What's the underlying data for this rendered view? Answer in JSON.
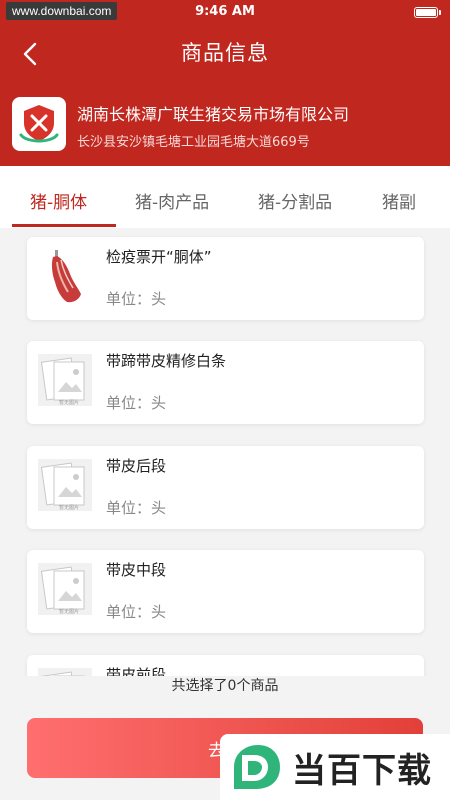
{
  "status": {
    "watermark_url": "www.downbai.com",
    "time": "9:46 AM"
  },
  "header": {
    "title": "商品信息",
    "company_name": "湖南长株潭广联生猪交易市场有限公司",
    "company_address": "长沙县安沙镇毛塘工业园毛塘大道669号"
  },
  "tabs": [
    {
      "label": "猪-胴体",
      "active": true
    },
    {
      "label": "猪-肉产品",
      "active": false
    },
    {
      "label": "猪-分割品",
      "active": false
    },
    {
      "label": "猪副",
      "active": false
    }
  ],
  "products": [
    {
      "title": "检疫票开“胴体”",
      "unit": "单位：头",
      "image": "pork-carcass"
    },
    {
      "title": "带蹄带皮精修白条",
      "unit": "单位：头",
      "image": "image-placeholder"
    },
    {
      "title": "带皮后段",
      "unit": "单位：头",
      "image": "image-placeholder"
    },
    {
      "title": "带皮中段",
      "unit": "单位：头",
      "image": "image-placeholder"
    },
    {
      "title": "带皮前段",
      "unit": "",
      "image": "image-placeholder"
    }
  ],
  "placeholder_caption": "暂无图片",
  "summary": "共选择了0个商品",
  "submit_button": "去下",
  "brand_badge": "当百下载",
  "colors": {
    "primary": "#c0271f",
    "button_start": "#ff6f6f",
    "button_end": "#e24038"
  }
}
